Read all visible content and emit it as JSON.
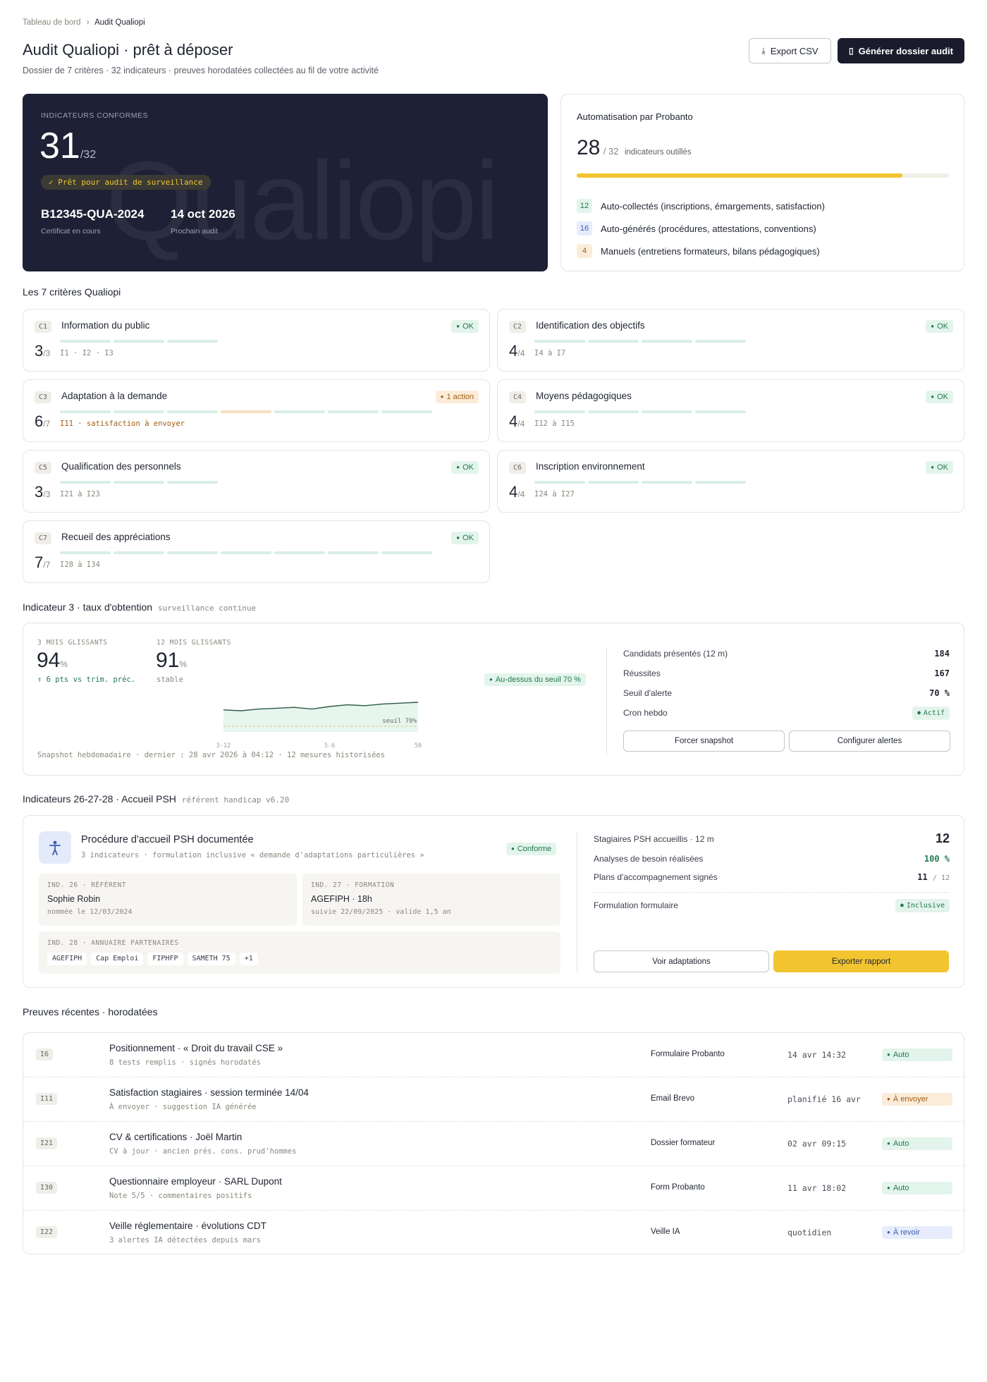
{
  "breadcrumb": {
    "root": "Tableau de bord",
    "current": "Audit Qualiopi"
  },
  "header": {
    "title": "Audit Qualiopi · prêt à déposer",
    "subtitle": "Dossier de 7 critères · 32 indicateurs · preuves horodatées collectées au fil de votre activité",
    "export_label": "Export CSV",
    "generate_label": "Générer dossier audit"
  },
  "hero": {
    "label": "INDICATEURS CONFORMES",
    "count": "31",
    "total": "/32",
    "badge": "✓ Prêt pour audit de surveillance",
    "watermark": "Qualiopi",
    "cert_value": "B12345-QUA-2024",
    "cert_label": "Certificat en cours",
    "audit_value": "14 oct 2026",
    "audit_label": "Prochain audit"
  },
  "automation": {
    "title": "Automatisation par Probanto",
    "count": "28",
    "total": "/ 32",
    "unit": "indicateurs outillés",
    "progress": 0.875,
    "items": [
      {
        "n": "12",
        "label": "Auto-collectés (inscriptions, émargements, satisfaction)"
      },
      {
        "n": "16",
        "label": "Auto-générés (procédures, attestations, conventions)"
      },
      {
        "n": "4",
        "label": "Manuels (entretiens formateurs, bilans pédagogiques)"
      }
    ]
  },
  "criteria_title": "Les 7 critères Qualiopi",
  "criteria": [
    {
      "code": "C1",
      "name": "Information du public",
      "status": "OK",
      "score": "3",
      "of": "/3",
      "ind": "I1 · I2 · I3"
    },
    {
      "code": "C2",
      "name": "Identification des objectifs",
      "status": "OK",
      "score": "4",
      "of": "/4",
      "ind": "I4 à I7"
    },
    {
      "code": "C3",
      "name": "Adaptation à la demande",
      "status": "1 action",
      "score": "6",
      "of": "/7",
      "ind": "I11 · satisfaction à envoyer"
    },
    {
      "code": "C4",
      "name": "Moyens pédagogiques",
      "status": "OK",
      "score": "4",
      "of": "/4",
      "ind": "I12 à I15"
    },
    {
      "code": "C5",
      "name": "Qualification des personnels",
      "status": "OK",
      "score": "3",
      "of": "/3",
      "ind": "I21 à I23"
    },
    {
      "code": "C6",
      "name": "Inscription environnement",
      "status": "OK",
      "score": "4",
      "of": "/4",
      "ind": "I24 à I27"
    },
    {
      "code": "C7",
      "name": "Recueil des appréciations",
      "status": "OK",
      "score": "7",
      "of": "/7",
      "ind": "I28 à I34"
    }
  ],
  "ind3": {
    "title": "Indicateur 3 · taux d'obtention",
    "sub": "surveillance continue",
    "m3_label": "3 MOIS GLISSANTS",
    "m3_value": "94",
    "m3_unit": "%",
    "m3_delta": "↑ 6 pts vs trim. préc.",
    "m12_label": "12 MOIS GLISSANTS",
    "m12_value": "91",
    "m12_unit": "%",
    "m12_note": "stable",
    "badge": "Au-dessus du seuil 70 %",
    "snapshot": "Snapshot hebdomadaire · dernier : 28 avr 2026 à 04:12 · 12 mesures historisées",
    "stats": [
      {
        "label": "Candidats présentés (12 m)",
        "value": "184"
      },
      {
        "label": "Réussites",
        "value": "167"
      },
      {
        "label": "Seuil d'alerte",
        "value": "70 %"
      }
    ],
    "cron_label": "Cron hebdo",
    "cron_status": "Actif",
    "force_label": "Forcer snapshot",
    "config_label": "Configurer alertes"
  },
  "chart_data": {
    "type": "line",
    "title": "",
    "x": [
      "3-12",
      "",
      "",
      "",
      "",
      "",
      "5-6",
      "",
      "",
      "",
      "",
      "50"
    ],
    "tick_labels": [
      "3-12",
      "5-6",
      "50"
    ],
    "series": [
      {
        "values": [
          90,
          89.5,
          90.5,
          91,
          91.5,
          90.5,
          92,
          93,
          92.5,
          93.5,
          94,
          94.5
        ]
      }
    ],
    "threshold": {
      "value": 70,
      "label": "seuil 70%"
    },
    "ylim": [
      60,
      100
    ]
  },
  "psh": {
    "title": "Indicateurs 26-27-28 · Accueil PSH",
    "sub": "référent handicap v6.20",
    "proc_title": "Procédure d'accueil PSH documentée",
    "proc_sub": "3 indicateurs · formulation inclusive « demande d'adaptations particulières »",
    "proc_status": "Conforme",
    "i26_label": "IND. 26 · RÉFÉRENT",
    "i26_name": "Sophie Robin",
    "i26_sub": "nommée le 12/03/2024",
    "i27_label": "IND. 27 · FORMATION",
    "i27_name": "AGEFIPH · 18h",
    "i27_sub": "suivie 22/09/2025 · valide 1,5 an",
    "i28_label": "IND. 28 · ANNUAIRE PARTENAIRES",
    "partners": [
      "AGEFIPH",
      "Cap Emploi",
      "FIPHFP",
      "SAMETH 75",
      "+1"
    ],
    "stats": [
      {
        "label": "Stagiaires PSH accueillis · 12 m",
        "value": "12"
      },
      {
        "label": "Analyses de besoin réalisées",
        "value": "100 %"
      },
      {
        "label": "Plans d'accompagnement signés",
        "value": "11",
        "of": "/ 12"
      }
    ],
    "form_label": "Formulation formulaire",
    "form_status": "Inclusive",
    "see_label": "Voir adaptations",
    "export_label": "Exporter rapport"
  },
  "proofs": {
    "title": "Preuves récentes · horodatées",
    "rows": [
      {
        "code": "I6",
        "title": "Positionnement · « Droit du travail CSE »",
        "sub": "8 tests remplis · signés horodatés",
        "src": "Formulaire Probanto",
        "time": "14 avr 14:32",
        "status": "Auto",
        "kind": "g"
      },
      {
        "code": "I11",
        "title": "Satisfaction stagiaires · session terminée 14/04",
        "sub": "À envoyer · suggestion IA générée",
        "src": "Email Brevo",
        "time": "planifié 16 avr",
        "status": "À envoyer",
        "kind": "o"
      },
      {
        "code": "I21",
        "title": "CV & certifications · Joël Martin",
        "sub": "CV à jour · ancien prés. cons. prud'hommes",
        "src": "Dossier formateur",
        "time": "02 avr 09:15",
        "status": "Auto",
        "kind": "g"
      },
      {
        "code": "I30",
        "title": "Questionnaire employeur · SARL Dupont",
        "sub": "Note 5/5 · commentaires positifs",
        "src": "Form Probanto",
        "time": "11 avr 18:02",
        "status": "Auto",
        "kind": "g"
      },
      {
        "code": "I22",
        "title": "Veille réglementaire · évolutions CDT",
        "sub": "3 alertes IA détectées depuis mars",
        "src": "Veille IA",
        "time": "quotidien",
        "status": "À revoir",
        "kind": "b"
      }
    ]
  },
  "colors": {
    "accent": "#f2c530",
    "dark": "#1a1c2c",
    "ok": "#217a4d",
    "warn": "#a25d11"
  }
}
